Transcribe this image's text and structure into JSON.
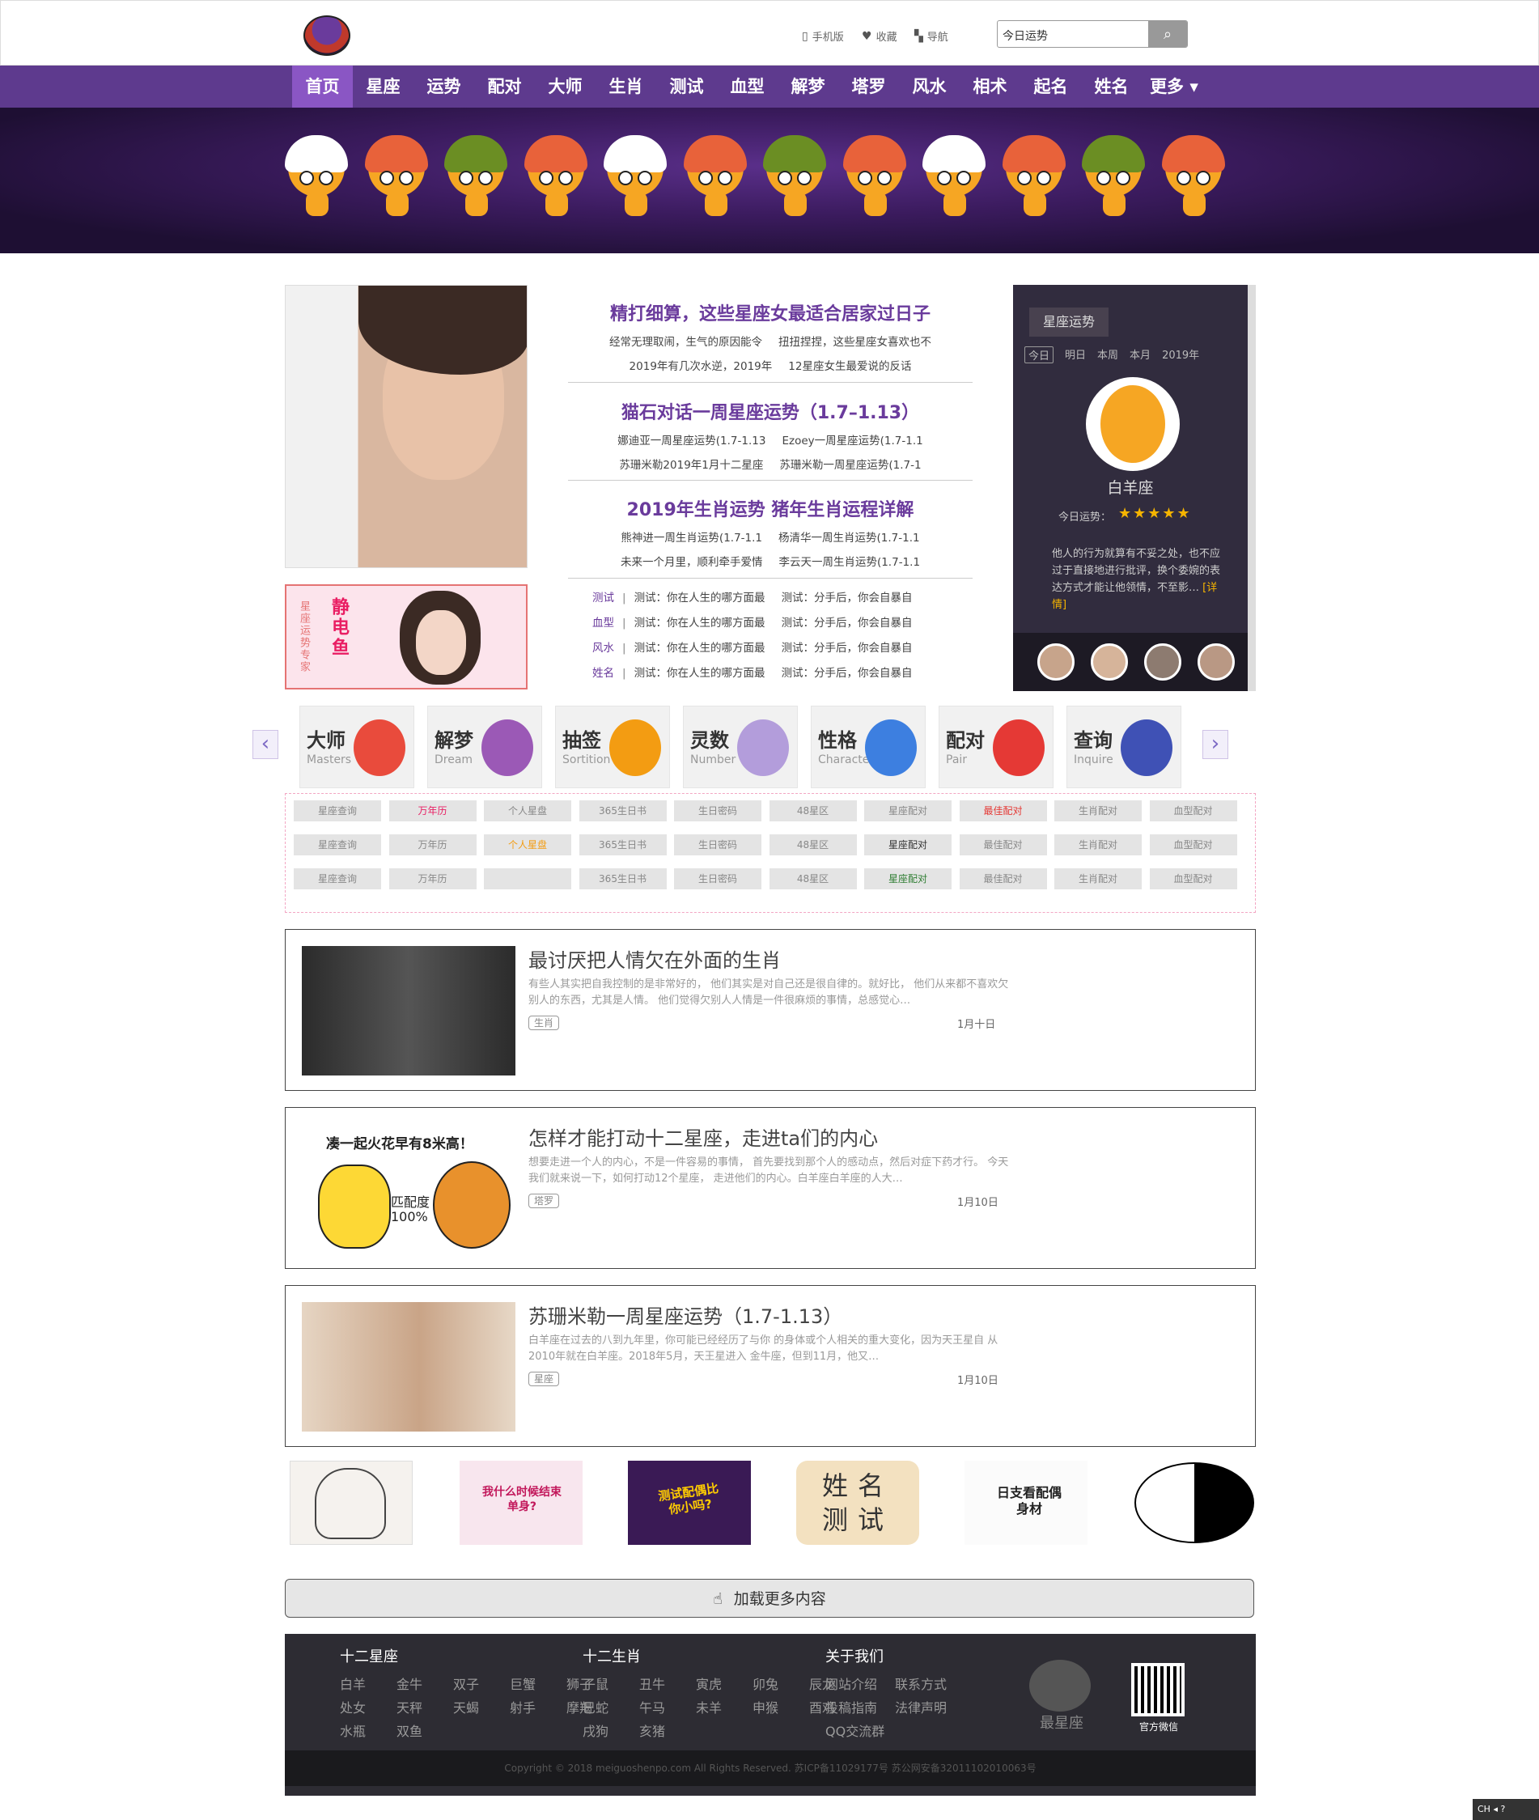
{
  "header": {
    "links": [
      {
        "icon": "mobile-icon",
        "label": "手机版"
      },
      {
        "icon": "heart-icon",
        "label": "收藏"
      },
      {
        "icon": "nav-icon",
        "label": "导航"
      }
    ],
    "search_value": "今日运势"
  },
  "nav": [
    "首页",
    "星座",
    "运势",
    "配对",
    "大师",
    "生肖",
    "测试",
    "血型",
    "解梦",
    "塔罗",
    "风水",
    "相术",
    "起名",
    "姓名",
    "更多 ▾"
  ],
  "news": [
    {
      "title": "精打细算，这些星座女最适合居家过日子",
      "lines": [
        [
          "经常无理取闹，生气的原因能令",
          "扭扭捏捏，这些星座女喜欢也不"
        ],
        [
          "2019年有几次水逆，2019年",
          "12星座女生最爱说的反话"
        ]
      ]
    },
    {
      "title": "猫石对话一周星座运势（1.7–1.13）",
      "lines": [
        [
          "娜迪亚一周星座运势(1.7-1.13",
          "Ezoey一周星座运势(1.7-1.1"
        ],
        [
          "苏珊米勒2019年1月十二星座",
          "苏珊米勒一周星座运势(1.7-1"
        ]
      ]
    },
    {
      "title": "2019年生肖运势 猪年生肖运程详解",
      "lines": [
        [
          "熊神进一周生肖运势(1.7-1.1",
          "杨清华一周生肖运势(1.7-1.1"
        ],
        [
          "未来一个月里，顺利牵手爱情",
          "李云天一周生肖运势(1.7-1.1"
        ]
      ]
    }
  ],
  "tag_rows": [
    {
      "tag": "测试",
      "a": "测试：你在人生的哪方面最",
      "b": "测试：分手后，你会自暴自"
    },
    {
      "tag": "血型",
      "a": "测试：你在人生的哪方面最",
      "b": "测试：分手后，你会自暴自"
    },
    {
      "tag": "风水",
      "a": "测试：你在人生的哪方面最",
      "b": "测试：分手后，你会自暴自"
    },
    {
      "tag": "姓名",
      "a": "测试：你在人生的哪方面最",
      "b": "测试：分手后，你会自暴自"
    }
  ],
  "side_promo": {
    "vertical_small": "星座运势专家",
    "vertical_big": "静电鱼"
  },
  "horoscope": {
    "header": "星座运势",
    "tabs": [
      "今日",
      "明日",
      "本周",
      "本月",
      "2019年"
    ],
    "sign": "白羊座",
    "today_label": "今日运势：",
    "stars": "★★★★★",
    "desc": "他人的行为就算有不妥之处，也不应过于直接地进行批评，换个委婉的表达方式才能让他领情，不至影…",
    "more": "[详情]"
  },
  "categories": [
    {
      "cn": "大师",
      "en": "Masters",
      "color": "#e94b3c"
    },
    {
      "cn": "解梦",
      "en": "Dream",
      "color": "#9b59b6"
    },
    {
      "cn": "抽签",
      "en": "Sortition",
      "color": "#f39c12"
    },
    {
      "cn": "灵数",
      "en": "Number",
      "color": "#b39ddb"
    },
    {
      "cn": "性格",
      "en": "Character",
      "color": "#3d7fe0"
    },
    {
      "cn": "配对",
      "en": "Pair",
      "color": "#e53935"
    },
    {
      "cn": "查询",
      "en": "Inquire",
      "color": "#3f51b5"
    }
  ],
  "grid": [
    [
      "星座查询",
      "万年历",
      "个人星盘",
      "365生日书",
      "生日密码",
      "48星区",
      "星座配对",
      "最佳配对",
      "生肖配对",
      "血型配对"
    ],
    [
      "星座查询",
      "万年历",
      "个人星盘",
      "365生日书",
      "生日密码",
      "48星区",
      "星座配对",
      "最佳配对",
      "生肖配对",
      "血型配对"
    ],
    [
      "星座查询",
      "万年历",
      "",
      "365生日书",
      "生日密码",
      "48星区",
      "星座配对",
      "最佳配对",
      "生肖配对",
      "血型配对"
    ]
  ],
  "articles": [
    {
      "title": "最讨厌把人情欠在外面的生肖",
      "desc": "有些人其实把自我控制的是非常好的， 他们其实是对自己还是很自律的。就好比， 他们从来都不喜欢欠别人的东西，尤其是人情。 他们觉得欠别人人情是一件很麻烦的事情，总感觉心…",
      "tag": "生肖",
      "date": "1月十日"
    },
    {
      "title": "怎样才能打动十二星座，走进ta们的内心",
      "desc": "想要走进一个人的内心，不是一件容易的事情， 首先要找到那个人的感动点，然后对症下药才行。 今天我们就来说一下，如何打动12个星座， 走进他们的内心。白羊座白羊座的人大…",
      "tag": "塔罗",
      "date": "1月10日",
      "caption": "凑一起火花早有8米高！",
      "match": "匹配度 100%"
    },
    {
      "title": "苏珊米勒一周星座运势（1.7-1.13）",
      "desc": "白羊座在过去的八到九年里，你可能已经经历了与你 的身体或个人相关的重大变化，因为天王星自 从2010年就在白羊座。2018年5月，天王星进入 金牛座，但到11月，他又…",
      "tag": "星座",
      "date": "1月10日"
    }
  ],
  "thumbs": [
    {
      "label": ""
    },
    {
      "label": "我什么时候结束单身?"
    },
    {
      "label": "测试配偶比你小吗?"
    },
    {
      "label": "姓名测试"
    },
    {
      "label": "日支看配偶身材"
    },
    {
      "label": ""
    }
  ],
  "load_more": "加载更多内容",
  "footer": {
    "col1": {
      "title": "十二星座",
      "rows": [
        [
          "白羊",
          "金牛",
          "双子",
          "巨蟹",
          "狮子"
        ],
        [
          "处女",
          "天秤",
          "天蝎",
          "射手",
          "摩羯"
        ],
        [
          "水瓶",
          "双鱼"
        ]
      ]
    },
    "col2": {
      "title": "十二生肖",
      "rows": [
        [
          "子鼠",
          "丑牛",
          "寅虎",
          "卯兔",
          "辰龙"
        ],
        [
          "巳蛇",
          "午马",
          "未羊",
          "申猴",
          "酉鸡"
        ],
        [
          "戌狗",
          "亥猪"
        ]
      ]
    },
    "col3": {
      "title": "关于我们",
      "rows": [
        [
          "网站介绍",
          "联系方式"
        ],
        [
          "投稿指南",
          "法律声明"
        ],
        [
          "QQ交流群"
        ]
      ]
    },
    "logo_label": "最星座",
    "qr_label": "官方微信",
    "copyright": "Copyright © 2018 meiguoshenpo.com All Rights Reserved.    苏ICP备11029177号    苏公网安备32011102010063号"
  },
  "corner": "CH ◂ ?"
}
